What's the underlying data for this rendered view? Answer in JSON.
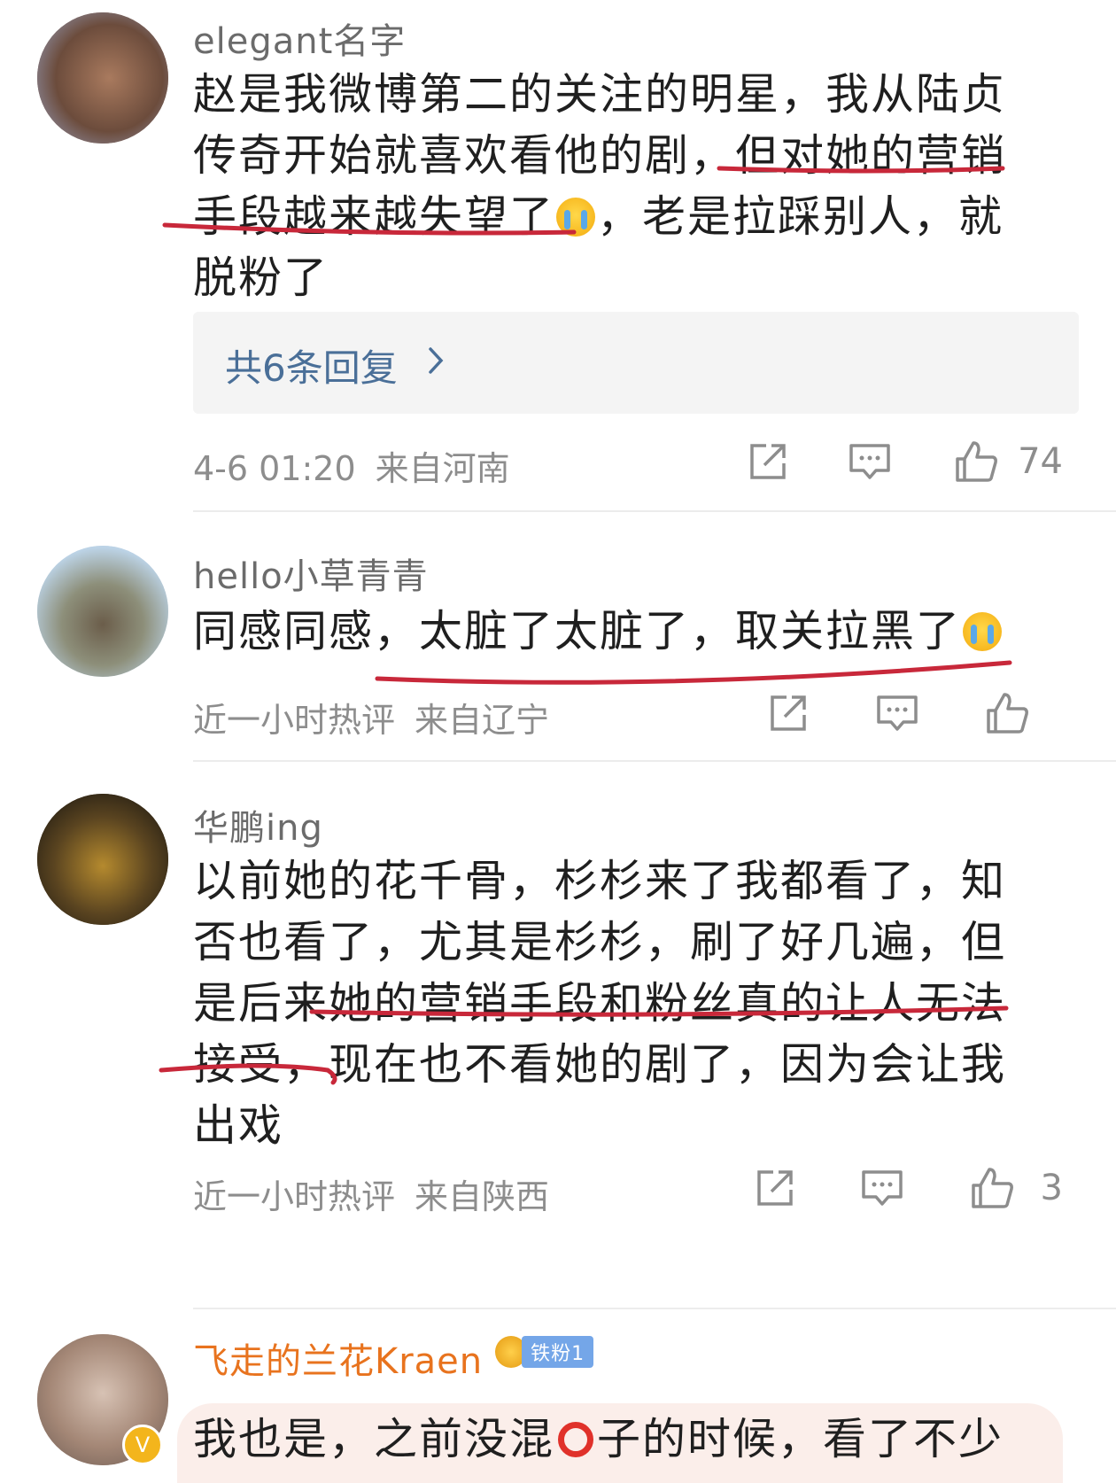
{
  "comments": [
    {
      "username": "elegant名字",
      "text_before": "赵是我微博第二的关注的明星，我从陆贞传奇开始就喜欢看他的剧，但对她的营销手段越来越失望了",
      "text_after": "，老是拉踩别人，就脱粉了",
      "replies_label": "共6条回复",
      "time": "4-6 01:20",
      "location": "来自河南",
      "like_count": "74"
    },
    {
      "username": "hello小草青青",
      "text_before": "同感同感，太脏了太脏了，取关拉黑了",
      "text_after": "",
      "time": "近一小时热评",
      "location": "来自辽宁",
      "like_count": ""
    },
    {
      "username": "华鹏ing",
      "text_before": "以前她的花千骨，杉杉来了我都看了，知否也看了，尤其是杉杉，刷了好几遍，但是后来她的营销手段和粉丝真的让人无法接受，现在也不看她的剧了，因为会让我出戏",
      "text_after": "",
      "time": "近一小时热评",
      "location": "来自陕西",
      "like_count": "3"
    },
    {
      "username": "飞走的兰花Kraen",
      "badge": "铁粉1",
      "text_before": "我也是，之前没混",
      "text_after": "子的时候，看了不少"
    }
  ],
  "icons": {
    "share": "share-icon",
    "comment": "comment-icon",
    "like": "thumbs-up-icon",
    "chevron": "chevron-right-icon",
    "emoji": "crying-emoji-icon",
    "verified": "verified-v-icon"
  },
  "colors": {
    "annotation_red": "#c8283a",
    "reply_link": "#4a6f98",
    "username_highlight": "#e8731e"
  },
  "verified_mark": "V"
}
